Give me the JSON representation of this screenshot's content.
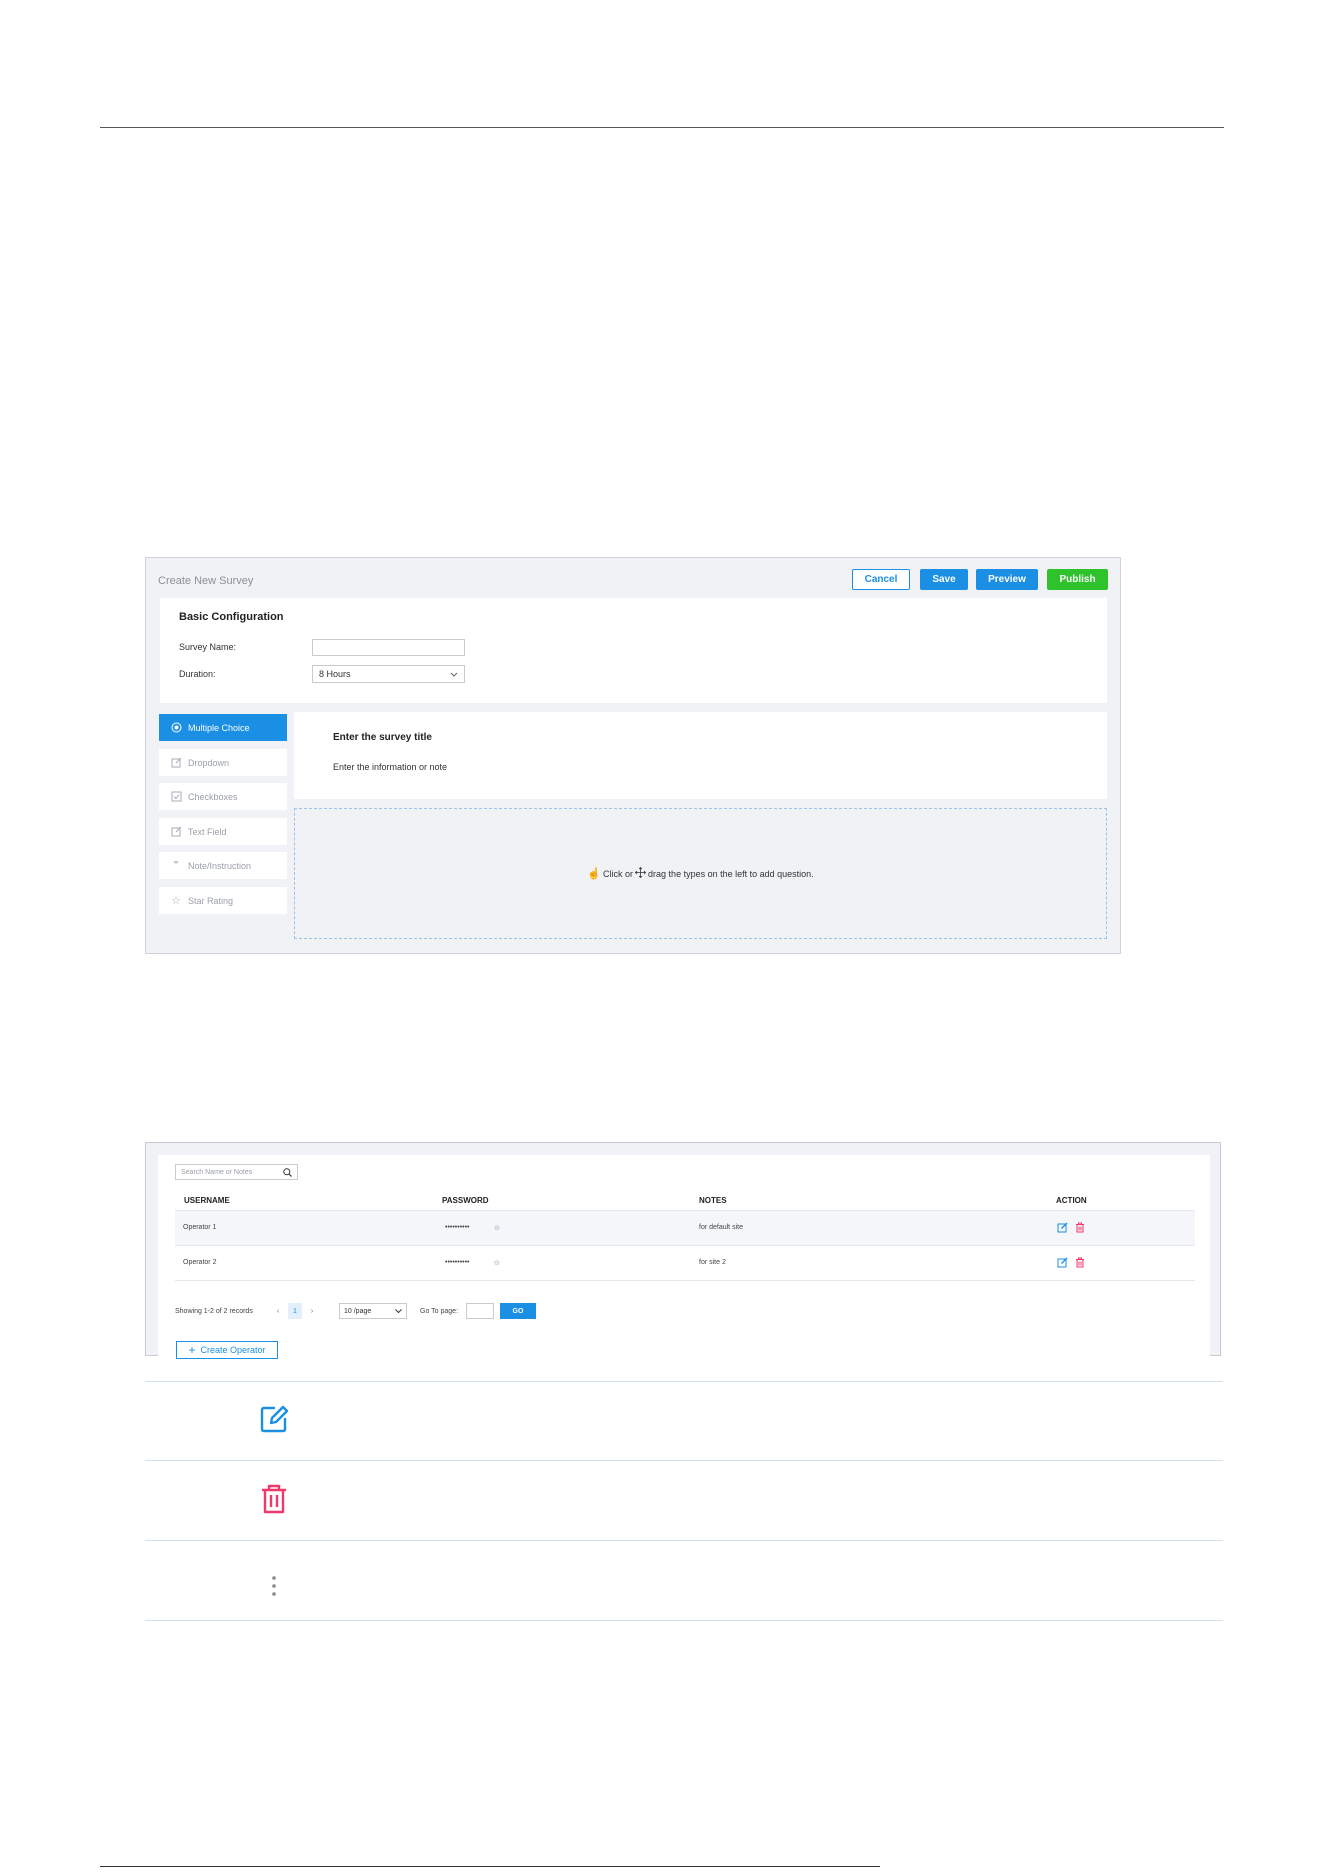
{
  "survey": {
    "title": "Create New Survey",
    "buttons": {
      "cancel": "Cancel",
      "save": "Save",
      "preview": "Preview",
      "publish": "Publish"
    },
    "basic": {
      "heading": "Basic Configuration",
      "survey_name_label": "Survey Name:",
      "survey_name_value": "",
      "duration_label": "Duration:",
      "duration_value": "8 Hours"
    },
    "types": [
      {
        "label": "Multiple Choice",
        "icon": "radio-icon",
        "active": true
      },
      {
        "label": "Dropdown",
        "icon": "edit-icon",
        "active": false
      },
      {
        "label": "Checkboxes",
        "icon": "checkbox-icon",
        "active": false
      },
      {
        "label": "Text Field",
        "icon": "edit-icon",
        "active": false
      },
      {
        "label": "Note/Instruction",
        "icon": "quote-icon",
        "active": false
      },
      {
        "label": "Star Rating",
        "icon": "star-icon",
        "active": false
      }
    ],
    "title_placeholder": "Enter the survey title",
    "note_placeholder": "Enter the information or note",
    "drop_hint_1": "Click or",
    "drop_hint_2": "drag the types on the left to add question."
  },
  "operators": {
    "search_placeholder": "Search Name or Notes",
    "columns": {
      "username": "USERNAME",
      "password": "PASSWORD",
      "notes": "NOTES",
      "action": "ACTION"
    },
    "rows": [
      {
        "username": "Operator 1",
        "password": "••••••••••",
        "notes": "for default site"
      },
      {
        "username": "Operator 2",
        "password": "••••••••••",
        "notes": "for site 2"
      }
    ],
    "showing": "Showing 1-2 of 2 records",
    "current_page": "1",
    "page_size": "10 /page",
    "goto_label": "Go To page:",
    "go_button": "GO",
    "create_button": "Create Operator"
  },
  "colors": {
    "accent": "#1a8fe3",
    "publish": "#2ec22b",
    "danger": "#f0386b"
  }
}
